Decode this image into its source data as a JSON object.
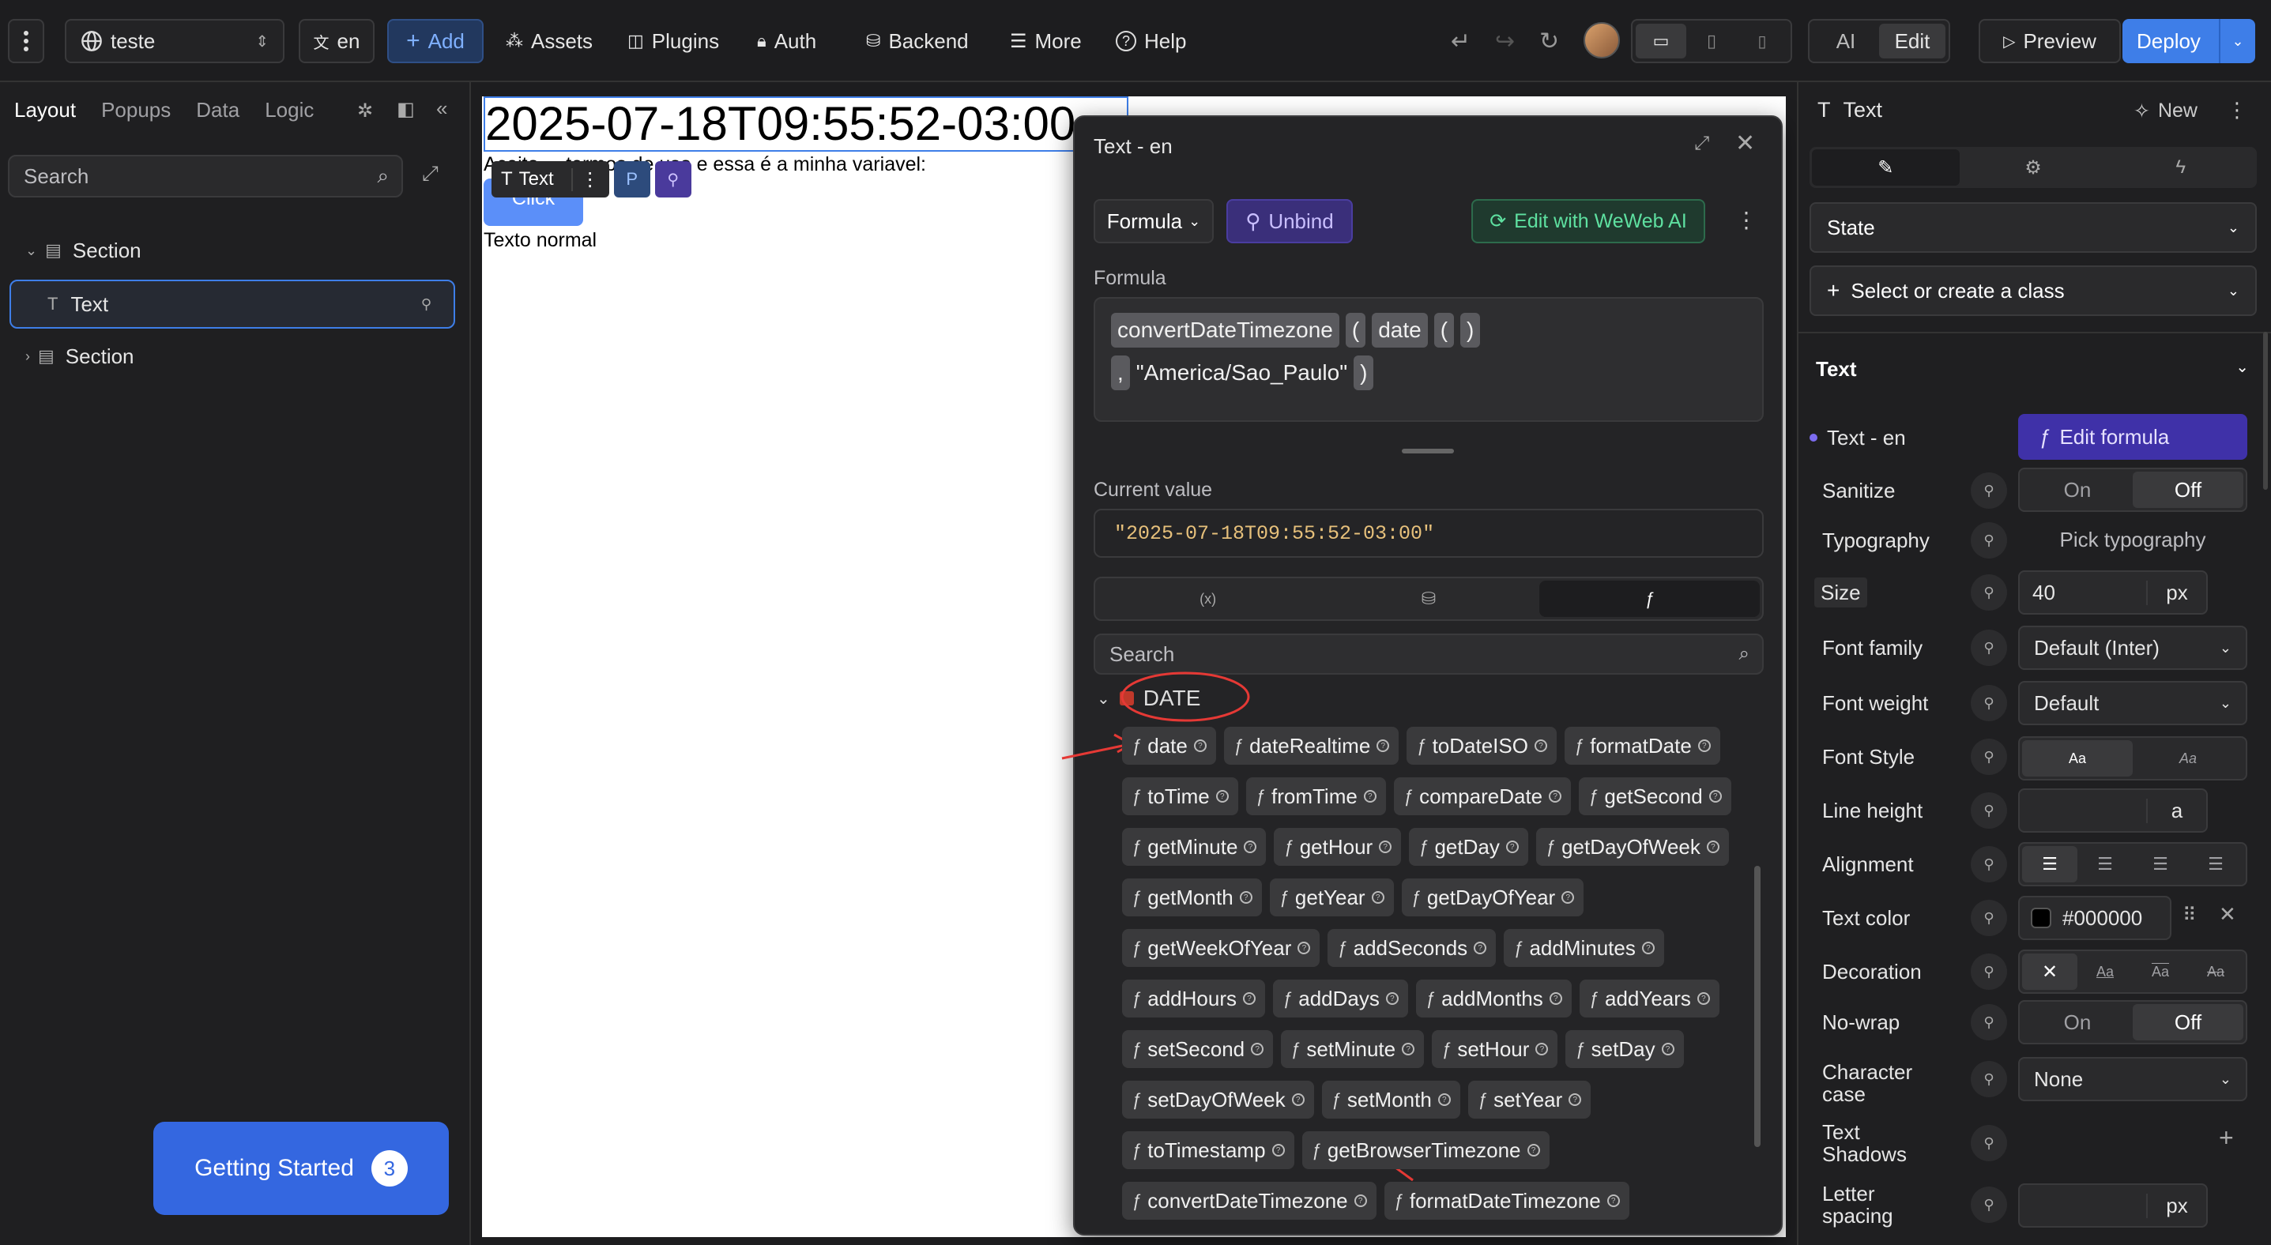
{
  "topbar": {
    "project": "teste",
    "lang": "en",
    "add": "Add",
    "assets": "Assets",
    "plugins": "Plugins",
    "auth": "Auth",
    "backend": "Backend",
    "more": "More",
    "help": "Help",
    "ai": "AI",
    "edit": "Edit",
    "preview": "Preview",
    "deploy": "Deploy"
  },
  "left": {
    "tabs": [
      "Layout",
      "Popups",
      "Data",
      "Logic"
    ],
    "search_placeholder": "Search",
    "tree": [
      {
        "label": "Section"
      },
      {
        "label": "Text"
      },
      {
        "label": "Section"
      }
    ],
    "getting_started": "Getting Started",
    "getting_started_count": "3"
  },
  "canvas": {
    "heading": "2025-07-18T09:55:52-03:00",
    "line": "Aceito ... termos de uso e essa é a minha variavel:",
    "button": "Click",
    "normal": "Texto normal",
    "toolbar_text": "Text",
    "toolbar_p": "P"
  },
  "modal": {
    "title": "Text - en",
    "formula_mode": "Formula",
    "unbind": "Unbind",
    "ai_button": "Edit with WeWeb AI",
    "formula_label": "Formula",
    "formula_tokens_line1": [
      "convertDateTimezone",
      "(",
      "date",
      "(",
      ")"
    ],
    "formula_tokens_line2": [
      ",",
      "\"America/Sao_Paulo\"",
      ")"
    ],
    "current_value_label": "Current value",
    "current_value": "\"2025-07-18T09:55:52-03:00\"",
    "tab_vars": "(x)",
    "search_placeholder": "Search",
    "category": "DATE",
    "functions": [
      [
        "date",
        "dateRealtime",
        "toDateISO",
        "formatDate"
      ],
      [
        "toTime",
        "fromTime",
        "compareDate",
        "getSecond"
      ],
      [
        "getMinute",
        "getHour",
        "getDay",
        "getDayOfWeek"
      ],
      [
        "getMonth",
        "getYear",
        "getDayOfYear"
      ],
      [
        "getWeekOfYear",
        "addSeconds",
        "addMinutes"
      ],
      [
        "addHours",
        "addDays",
        "addMonths",
        "addYears"
      ],
      [
        "setSecond",
        "setMinute",
        "setHour",
        "setDay"
      ],
      [
        "setDayOfWeek",
        "setMonth",
        "setYear"
      ],
      [
        "toTimestamp",
        "getBrowserTimezone"
      ],
      [
        "convertDateTimezone",
        "formatDateTimezone"
      ]
    ]
  },
  "right": {
    "header": "Text",
    "new": "New",
    "state": "State",
    "class": "Select or create a class",
    "section": "Text",
    "text_en": "Text - en",
    "edit_formula": "Edit formula",
    "sanitize": "Sanitize",
    "on": "On",
    "off": "Off",
    "typography": "Typography",
    "pick_typography": "Pick typography",
    "size": "Size",
    "size_value": "40",
    "size_unit": "px",
    "font_family": "Font family",
    "font_family_value": "Default (Inter)",
    "font_weight": "Font weight",
    "font_weight_value": "Default",
    "font_style": "Font Style",
    "aa": "Aa",
    "line_height": "Line height",
    "line_height_unit": "a",
    "alignment": "Alignment",
    "text_color": "Text color",
    "text_color_value": "#000000",
    "decoration": "Decoration",
    "no_wrap": "No-wrap",
    "char_case": "Character case",
    "char_case_value": "None",
    "text_shadows": "Text Shadows",
    "letter_spacing": "Letter spacing",
    "letter_spacing_unit": "px"
  },
  "colors": {
    "accent": "#4a8cf7",
    "purple": "#5b4bc4",
    "green": "#3ecf8e",
    "deploy": "#3e7ee8"
  }
}
